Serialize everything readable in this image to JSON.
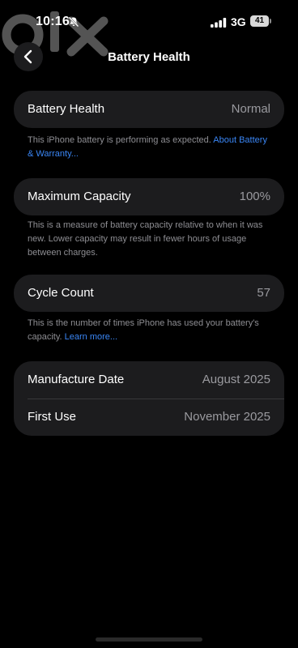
{
  "status_bar": {
    "time": "10:16",
    "network": "3G",
    "battery_level": "41",
    "silent_mode": true
  },
  "watermark": {
    "text": "olx"
  },
  "nav": {
    "title": "Battery Health",
    "back_icon": "chevron-left-icon"
  },
  "battery_health": {
    "label": "Battery Health",
    "value": "Normal",
    "note_text": "This iPhone battery is performing as expected. ",
    "note_link": "About Battery & Warranty..."
  },
  "maximum_capacity": {
    "label": "Maximum Capacity",
    "value": "100%",
    "note_text": "This is a measure of battery capacity relative to when it was new. Lower capacity may result in fewer hours of usage between charges."
  },
  "cycle_count": {
    "label": "Cycle Count",
    "value": "57",
    "note_text": "This is the number of times iPhone has used your battery's capacity. ",
    "note_link": "Learn more..."
  },
  "dates": {
    "manufacture_label": "Manufacture Date",
    "manufacture_value": "August 2025",
    "first_use_label": "First Use",
    "first_use_value": "November 2025"
  },
  "colors": {
    "background": "#000000",
    "card": "#1c1c1e",
    "link": "#3a86f5",
    "secondary_text": "#9a9a9f"
  }
}
